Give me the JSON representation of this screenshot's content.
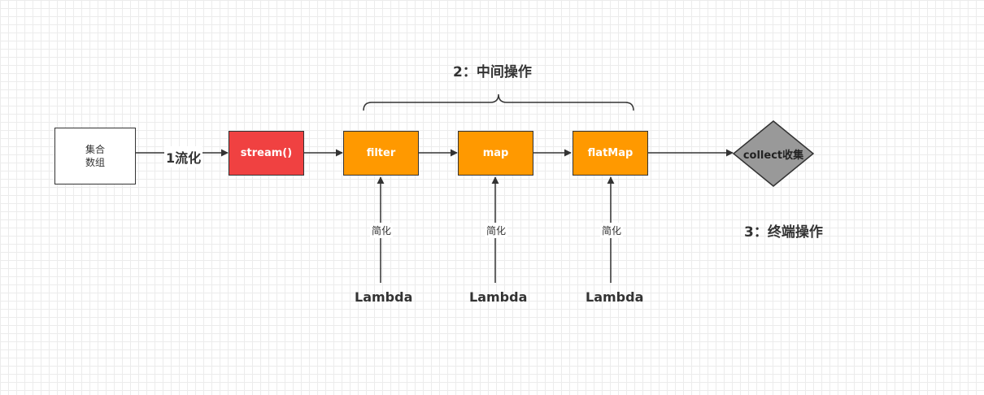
{
  "source_node": {
    "line1": "集合",
    "line2": "数组"
  },
  "stream_edge_label": "1流化",
  "stream_node": {
    "label": "stream()",
    "color": "#f04141"
  },
  "intermediate_ops": {
    "title": "2：中间操作",
    "color": "#ff9900",
    "items": [
      {
        "label": "filter"
      },
      {
        "label": "map"
      },
      {
        "label": "flatMap"
      }
    ]
  },
  "lambda_links": {
    "source_label": "Lambda",
    "edge_label": "简化"
  },
  "terminal": {
    "label": "collect收集",
    "title": "3：终端操作",
    "color": "#999999"
  }
}
